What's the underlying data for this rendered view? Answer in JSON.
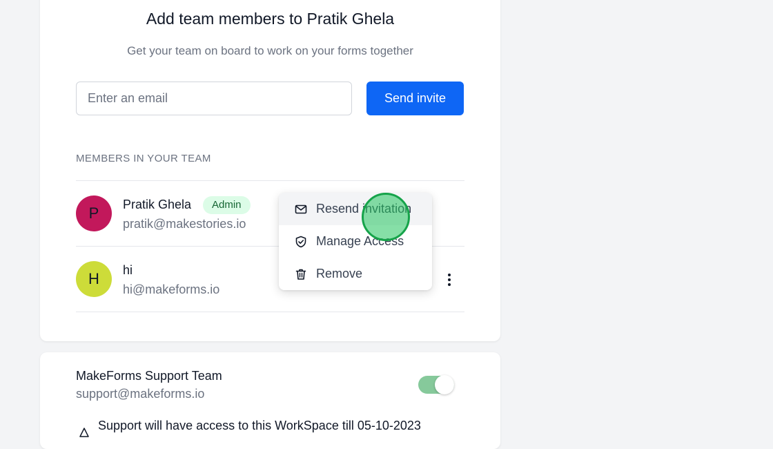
{
  "invite_card": {
    "title": "Add team members to Pratik Ghela",
    "subtitle": "Get your team on board to work on your forms together",
    "email_placeholder": "Enter an email",
    "send_button": "Send invite",
    "section_label": "MEMBERS IN YOUR TEAM"
  },
  "members": [
    {
      "initial": "P",
      "name": "Pratik Ghela",
      "email": "pratik@makestories.io",
      "badge": "Admin",
      "avatar_color": "#c2185b"
    },
    {
      "initial": "H",
      "name": "hi",
      "email": "hi@makeforms.io",
      "avatar_color": "#cddc39"
    }
  ],
  "context_menu": {
    "items": [
      {
        "label": "Resend invitation",
        "icon": "mail-icon"
      },
      {
        "label": "Manage Access",
        "icon": "shield-icon"
      },
      {
        "label": "Remove",
        "icon": "trash-icon"
      }
    ]
  },
  "support_card": {
    "name": "MakeForms Support Team",
    "email": "support@makeforms.io",
    "toggle_on": true,
    "note": "Support will have access to this WorkSpace till 05-10-2023"
  },
  "colors": {
    "primary": "#0e66f5",
    "badge_bg": "#dcfce7",
    "toggle_on": "#86c99b"
  }
}
